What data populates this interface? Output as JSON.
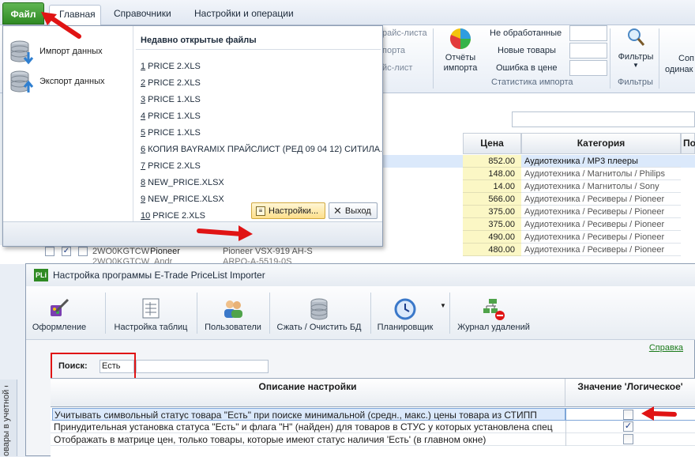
{
  "ribbon": {
    "tabs": [
      {
        "label": "Файл"
      },
      {
        "label": "Главная"
      },
      {
        "label": "Справочники"
      },
      {
        "label": "Настройки и операции"
      }
    ],
    "partial_left": [
      "райс-листа",
      "порта",
      "йс-лист"
    ],
    "stat_button": "Отчёты импорта",
    "stats": [
      {
        "label": "Не обработанные"
      },
      {
        "label": "Новые товары"
      },
      {
        "label": "Ошибка в цене"
      }
    ],
    "stat_group": "Статистика импорта",
    "filters_button": "Фильтры",
    "filters_group": "Фильтры",
    "partial_right": [
      "Соп",
      "одинак"
    ]
  },
  "grid": {
    "headers": [
      "Цена",
      "Категория",
      "По"
    ],
    "rows": [
      {
        "price": "852.00",
        "category": "Аудиотехника / MP3 плееры"
      },
      {
        "price": "148.00",
        "category": "Аудиотехника / Магнитолы / Philips"
      },
      {
        "price": "14.00",
        "category": "Аудиотехника / Магнитолы / Sony"
      },
      {
        "price": "566.00",
        "category": "Аудиотехника / Ресиверы / Pioneer"
      },
      {
        "price": "375.00",
        "category": "Аудиотехника / Ресиверы / Pioneer"
      },
      {
        "price": "375.00",
        "category": "Аудиотехника / Ресиверы / Pioneer"
      },
      {
        "price": "490.00",
        "category": "Аудиотехника / Ресиверы / Pioneer"
      },
      {
        "price": "480.00",
        "category": "Аудиотехника / Ресиверы / Pioneer"
      }
    ],
    "partial_row": {
      "code": "2WO0KGTCW",
      "brand": "Pioneer",
      "model": "Pioneer VSX-919 AH-S"
    },
    "partial_row2": {
      "code": "2WO0KGTCW",
      "brand": "Andr",
      "model": "ARPO-A-5519-0S"
    }
  },
  "file_menu": {
    "import_label": "Импорт данных",
    "export_label": "Экспорт данных",
    "recent_header": "Недавно открытые файлы",
    "recent_files": [
      {
        "num": "1",
        "name": " PRICE 2.XLS"
      },
      {
        "num": "2",
        "name": " PRICE 2.XLS"
      },
      {
        "num": "3",
        "name": " PRICE 1.XLS"
      },
      {
        "num": "4",
        "name": " PRICE 1.XLS"
      },
      {
        "num": "5",
        "name": " PRICE 1.XLS"
      },
      {
        "num": "6",
        "name": " КОПИЯ BAYRAMIX ПРАЙСЛИСТ (РЕД 09 04 12) СИТИЛА..."
      },
      {
        "num": "7",
        "name": " PRICE 2.XLS"
      },
      {
        "num": "8",
        "name": " NEW_PRICE.XLSX"
      },
      {
        "num": "9",
        "name": " NEW_PRICE.XLSX"
      },
      {
        "num": "10",
        "name": " PRICE 2.XLS"
      }
    ],
    "settings_button": "Настройки...",
    "exit_button": "Выход"
  },
  "settings_window": {
    "title": "Настройка программы E-Trade PriceList Importer",
    "logo": "PLi",
    "toolbar": [
      {
        "label": "Оформление"
      },
      {
        "label": "Настройка таблиц"
      },
      {
        "label": "Пользователи"
      },
      {
        "label": "Сжать / Очистить БД"
      },
      {
        "label": "Планировщик"
      },
      {
        "label": "Журнал удалений"
      }
    ],
    "help_link": "Справка",
    "search_label": "Поиск:",
    "search_value": "Есть",
    "columns": {
      "description": "Описание настройки",
      "value": "Значение 'Логическое'"
    },
    "rows": [
      {
        "description": "Учитывать символьный статус товара \"Есть\" при поиске минимальной (средн., макс.) цены товара из СТИПП",
        "checked": false
      },
      {
        "description": "Принудительная установка статуса \"Есть\" и флага \"Н\" (найден) для товаров в СТУС у которых установлена спец",
        "checked": true
      },
      {
        "description": "Отображать в матрице цен, только товары, которые имеют статус наличия 'Есть' (в главном окне)",
        "checked": false
      }
    ],
    "check_mark": "✓"
  },
  "side_panel": {
    "label": "овары в учетной системе"
  },
  "colors": {
    "accent_green": "#2f8a23",
    "arrow_red": "#e01414",
    "price_bg": "#fbf7c5"
  }
}
